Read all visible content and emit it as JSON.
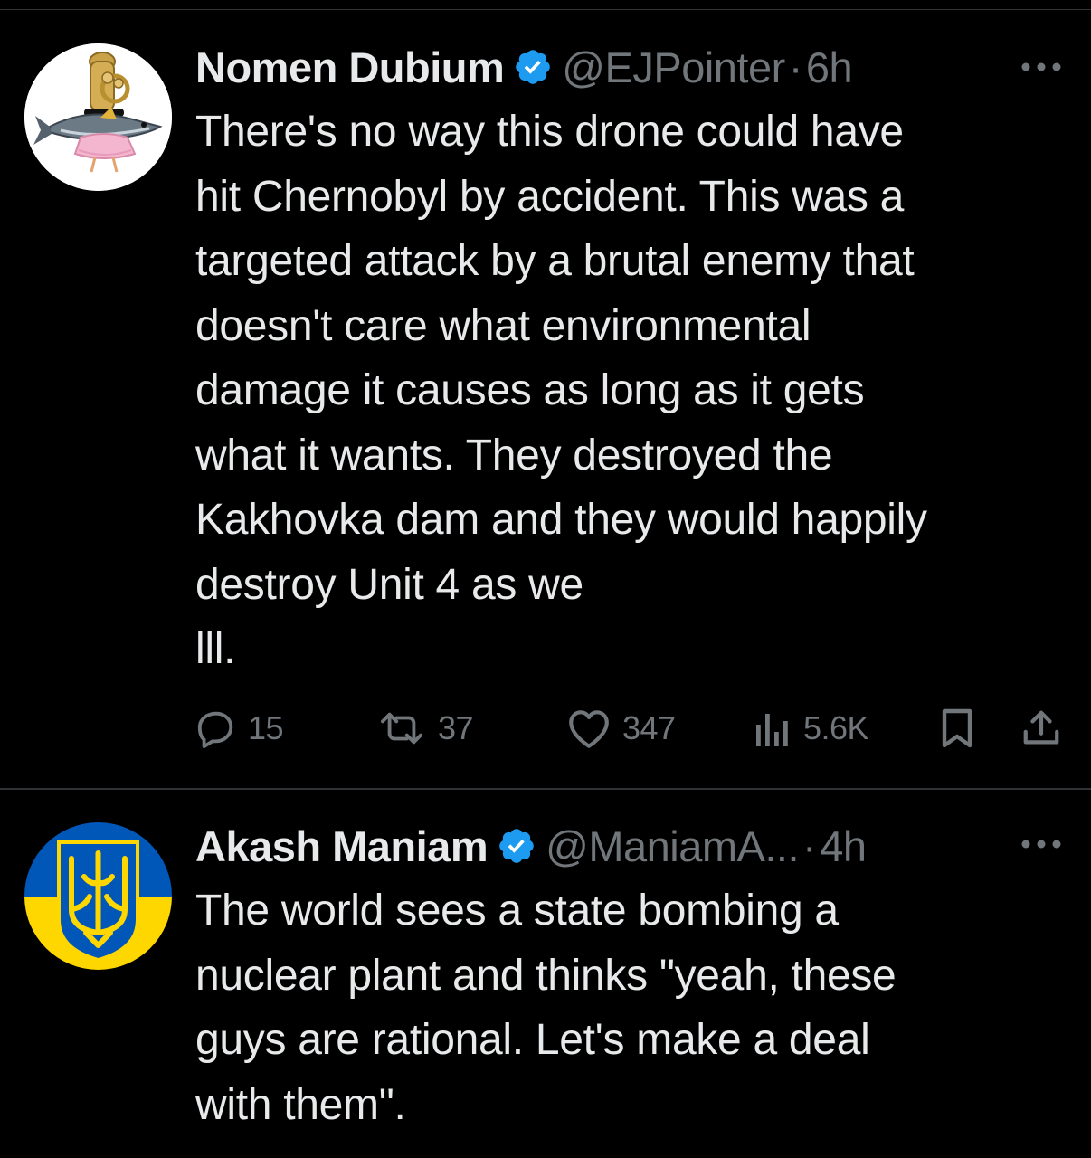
{
  "tweets": [
    {
      "display_name": "Nomen Dubium",
      "handle": "@EJPointer",
      "separator": "·",
      "time": "6h",
      "text": "There's no way this drone could have\nhit Chernobyl by accident.  This was a\ntargeted attack by a brutal enemy that\ndoesn't care what environmental\ndamage it causes as long as it gets\nwhat it wants.  They destroyed the\nKakhovka dam and they would happily\ndestroy Unit 4 as we\nlll.",
      "avatar_icon": "tuba-fish-tutu-avatar",
      "verified": true,
      "actions": {
        "replies": "15",
        "reposts": "37",
        "likes": "347",
        "views": "5.6K"
      }
    },
    {
      "display_name": "Akash Maniam",
      "handle": "@ManiamA...",
      "separator": "·",
      "time": "4h",
      "text": "The world sees a state bombing a\nnuclear plant and thinks \"yeah, these\nguys are rational. Let's make a deal\nwith them\".",
      "avatar_icon": "ukraine-trident-avatar",
      "verified": true
    }
  ],
  "colors": {
    "background": "#000000",
    "text_primary": "#e7e9ea",
    "text_secondary": "#71767b",
    "verified_blue": "#1d9bf0",
    "divider": "#2f3336",
    "flag_blue": "#0057b7",
    "flag_yellow": "#ffd700"
  }
}
